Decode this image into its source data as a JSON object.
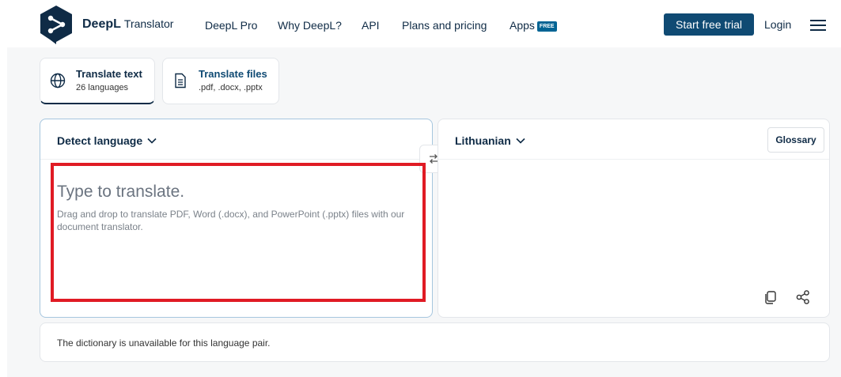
{
  "header": {
    "brand_name": "DeepL",
    "brand_sub": "Translator",
    "nav": [
      "DeepL Pro",
      "Why DeepL?",
      "API",
      "Plans and pricing",
      "Apps"
    ],
    "apps_badge": "FREE",
    "cta_label": "Start free trial",
    "login_label": "Login"
  },
  "mode_tabs": [
    {
      "title": "Translate text",
      "subtitle": "26 languages",
      "icon": "globe-icon",
      "active": true
    },
    {
      "title": "Translate files",
      "subtitle": ".pdf, .docx, .pptx",
      "icon": "document-icon",
      "active": false
    }
  ],
  "source": {
    "language": "Detect language",
    "placeholder": "Type to translate.",
    "hint": "Drag and drop to translate PDF, Word (.docx), and PowerPoint (.pptx) files with our document translator."
  },
  "target": {
    "language": "Lithuanian",
    "glossary_label": "Glossary"
  },
  "dictionary": {
    "message": "The dictionary is unavailable for this language pair."
  },
  "colors": {
    "brand_dark": "#0f2b46",
    "cta_bg": "#0f4a73",
    "highlight": "#e01b24",
    "badge": "#006494"
  }
}
